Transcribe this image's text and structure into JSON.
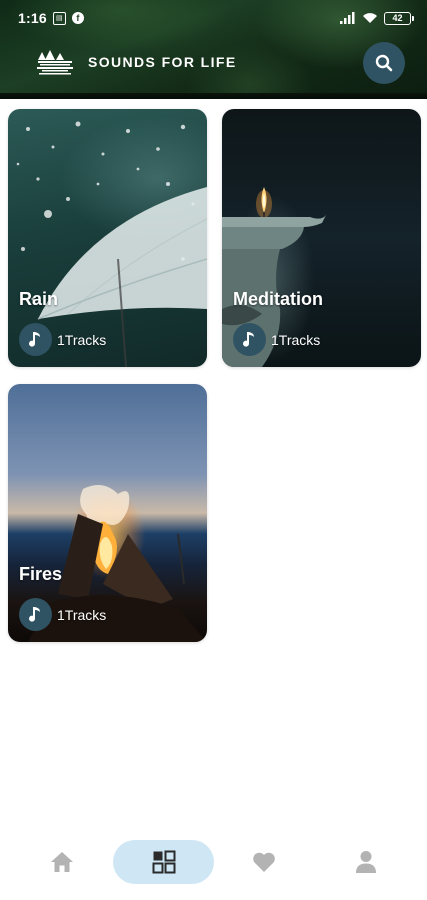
{
  "status_bar": {
    "time": "1:16",
    "notif_icon_text": "⚡",
    "battery": "42",
    "icons": [
      "notification-icon",
      "facebook-icon",
      "signal-icon",
      "wifi-icon",
      "battery-icon"
    ]
  },
  "header": {
    "title": "SOUNDS FOR LIFE",
    "logo_icon": "forest-logo-icon",
    "search_icon": "search-icon"
  },
  "categories": [
    {
      "title": "Rain",
      "tracks": "1Tracks",
      "icon": "music-note-icon"
    },
    {
      "title": "Meditation",
      "tracks": "1Tracks",
      "icon": "music-note-icon"
    },
    {
      "title": "Fires",
      "tracks": "1Tracks",
      "icon": "music-note-icon"
    }
  ],
  "bottom_nav": {
    "items": [
      {
        "icon": "home-icon",
        "active": false
      },
      {
        "icon": "grid-icon",
        "active": true
      },
      {
        "icon": "heart-icon",
        "active": false
      },
      {
        "icon": "user-icon",
        "active": false
      }
    ],
    "active_color": "#cfe7f4",
    "icon_color": "#b3b3b3"
  },
  "colors": {
    "accent": "#2f5362",
    "header_dark": "#132b17"
  }
}
